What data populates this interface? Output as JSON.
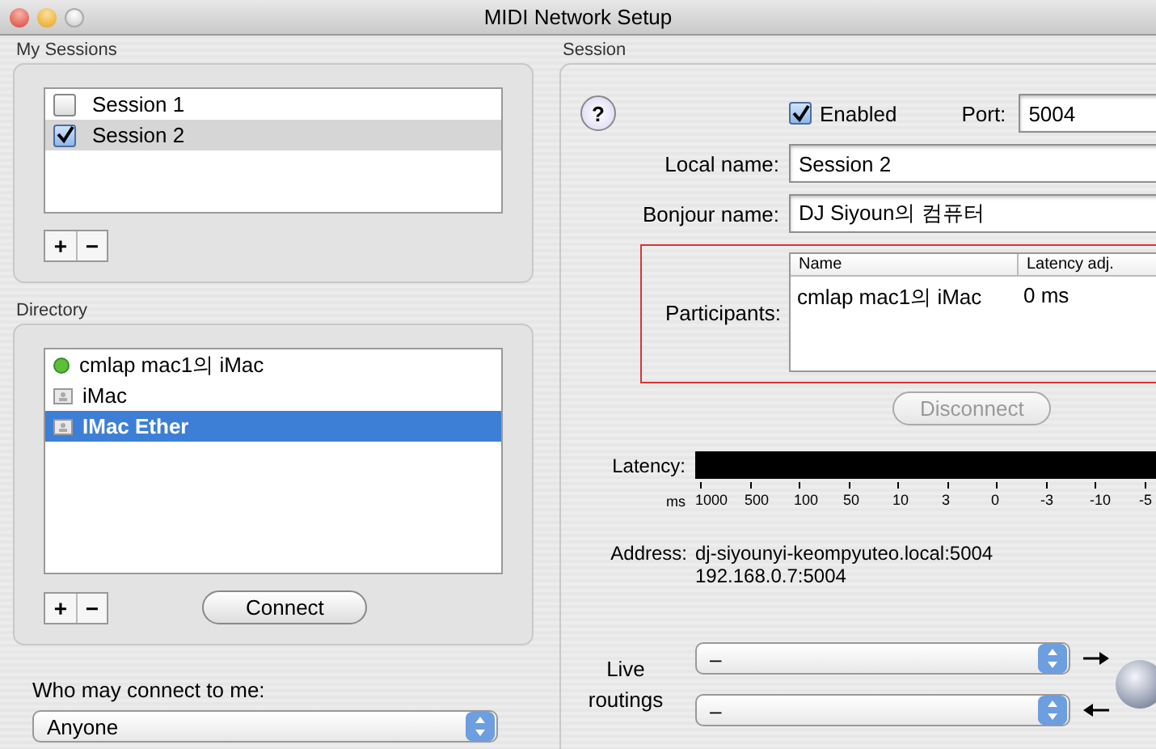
{
  "window": {
    "title": "MIDI Network Setup"
  },
  "my_sessions": {
    "label": "My Sessions",
    "add": "+",
    "remove": "−",
    "items": [
      {
        "name": "Session 1",
        "checked": false,
        "selected": false
      },
      {
        "name": "Session 2",
        "checked": true,
        "selected": true
      }
    ]
  },
  "directory": {
    "label": "Directory",
    "add": "+",
    "remove": "−",
    "connect": "Connect",
    "items": [
      {
        "name": "cmlap mac1의 iMac",
        "kind": "online",
        "selected": false
      },
      {
        "name": "iMac",
        "kind": "host",
        "selected": false
      },
      {
        "name": "IMac Ether",
        "kind": "host",
        "selected": true
      }
    ]
  },
  "who_may_connect": {
    "label": "Who may connect to me:",
    "value": "Anyone"
  },
  "session": {
    "label": "Session",
    "help": "?",
    "enabled": {
      "label": "Enabled",
      "checked": true
    },
    "port": {
      "label": "Port:",
      "value": "5004"
    },
    "local_name": {
      "label": "Local name:",
      "value": "Session 2"
    },
    "bonjour_name": {
      "label": "Bonjour name:",
      "value": "DJ Siyoun의 컴퓨터"
    },
    "participants": {
      "label": "Participants:",
      "columns": [
        "Name",
        "Latency adj."
      ],
      "rows": [
        [
          "cmlap mac1의 iMac",
          "0 ms"
        ]
      ]
    },
    "disconnect": {
      "label": "Disconnect",
      "disabled": true
    },
    "latency": {
      "label": "Latency:",
      "unit": "ms",
      "scale": [
        "1000",
        "500",
        "100",
        "50",
        "10",
        "3",
        "0",
        "-3",
        "-10",
        "-5"
      ]
    },
    "address": {
      "label": "Address:",
      "lines": [
        "dj-siyounyi-keompyuteo.local:5004",
        "192.168.0.7:5004"
      ]
    },
    "live_routings": {
      "label": "Live routings",
      "routes": [
        {
          "value": "–",
          "kind": "outgoing"
        },
        {
          "value": "–",
          "kind": "incoming"
        }
      ]
    }
  }
}
